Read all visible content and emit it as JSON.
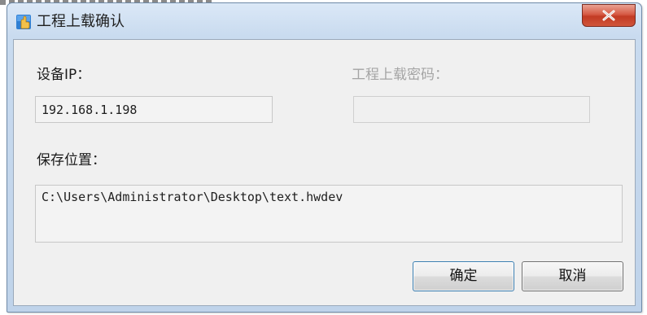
{
  "window": {
    "title": "工程上载确认",
    "icon": "download-hand-icon",
    "close_symbol": "close-icon"
  },
  "form": {
    "device_ip_label": "设备IP：",
    "device_ip_value": "192.168.1.198",
    "password_label": "工程上载密码：",
    "password_value": "",
    "save_location_label": "保存位置：",
    "save_location_value": "C:\\Users\\Administrator\\Desktop\\text.hwdev"
  },
  "buttons": {
    "confirm_label": "确定",
    "cancel_label": "取消"
  },
  "colors": {
    "title_bar": "#c9dbef",
    "close_button": "#c23b23",
    "client_background": "#f0f0f0",
    "disabled_text": "#a4a4a4"
  }
}
